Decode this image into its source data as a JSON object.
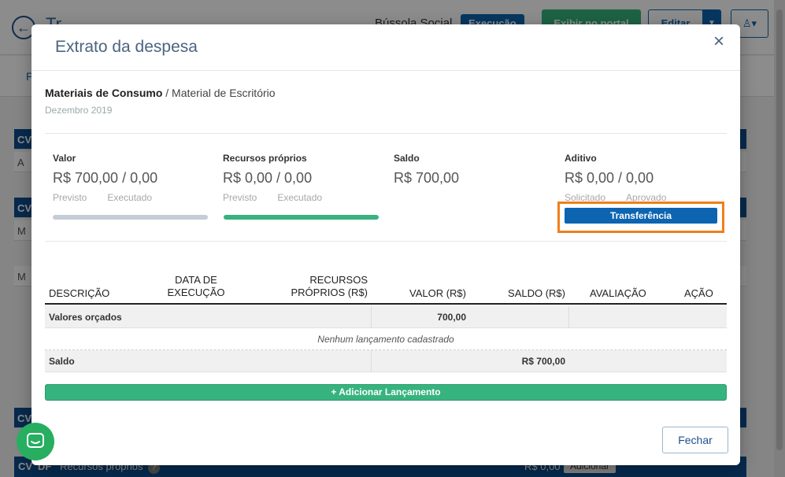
{
  "background": {
    "page_title": "Tr...",
    "bussola": "Bússola Social",
    "exec_badge": "Execução",
    "portal_button": "Exibir no portal",
    "edit_button": "Editar",
    "subbar_letter": "P",
    "rows": [
      "CV",
      "A",
      "CV",
      "M",
      "M",
      "CV"
    ],
    "bottom": {
      "cv": "CV",
      "df": "DF",
      "label": "Recursos próprios",
      "value": "R$ 0,00",
      "action": "Adicionar"
    }
  },
  "modal": {
    "title": "Extrato da despesa",
    "close_icon": "×",
    "breadcrumb": {
      "category": "Materiais de Consumo",
      "separator": "/",
      "subcategory": "Material de Escritório"
    },
    "period": "Dezembro 2019",
    "stats": {
      "valor": {
        "label": "Valor",
        "value": "R$ 700,00 / 0,00",
        "sub1": "Previsto",
        "sub2": "Executado",
        "progress": 0,
        "bar_color": "#c4cdd6"
      },
      "recursos": {
        "label": "Recursos próprios",
        "value": "R$ 0,00 / 0,00",
        "sub1": "Previsto",
        "sub2": "Executado",
        "progress": 1,
        "bar_color": "#36b37e"
      },
      "saldo": {
        "label": "Saldo",
        "value": "R$ 700,00"
      },
      "aditivo": {
        "label": "Aditivo",
        "value": "R$ 0,00 / 0,00",
        "sub1": "Solicitado",
        "sub2": "Aprovado"
      }
    },
    "transfer_button": "Transferência",
    "table": {
      "headers": {
        "descricao": "DESCRIÇÃO",
        "data_line1": "DATA DE",
        "data_line2": "EXECUÇÃO",
        "recursos_line1": "RECURSOS",
        "recursos_line2": "PRÓPRIOS (R$)",
        "valor": "VALOR (R$)",
        "saldo": "SALDO (R$)",
        "avaliacao": "AVALIAÇÃO",
        "acao": "AÇÃO"
      },
      "orcados": {
        "label": "Valores orçados",
        "valor": "700,00"
      },
      "empty_message": "Nenhum lançamento cadastrado",
      "saldo_row": {
        "label": "Saldo",
        "value": "R$ 700,00"
      }
    },
    "add_button": "+ Adicionar Lançamento",
    "close_button": "Fechar"
  },
  "colors": {
    "accent": "#0d64b0",
    "success": "#36b37e",
    "highlight": "#f07f1a",
    "title": "#4a6580"
  }
}
